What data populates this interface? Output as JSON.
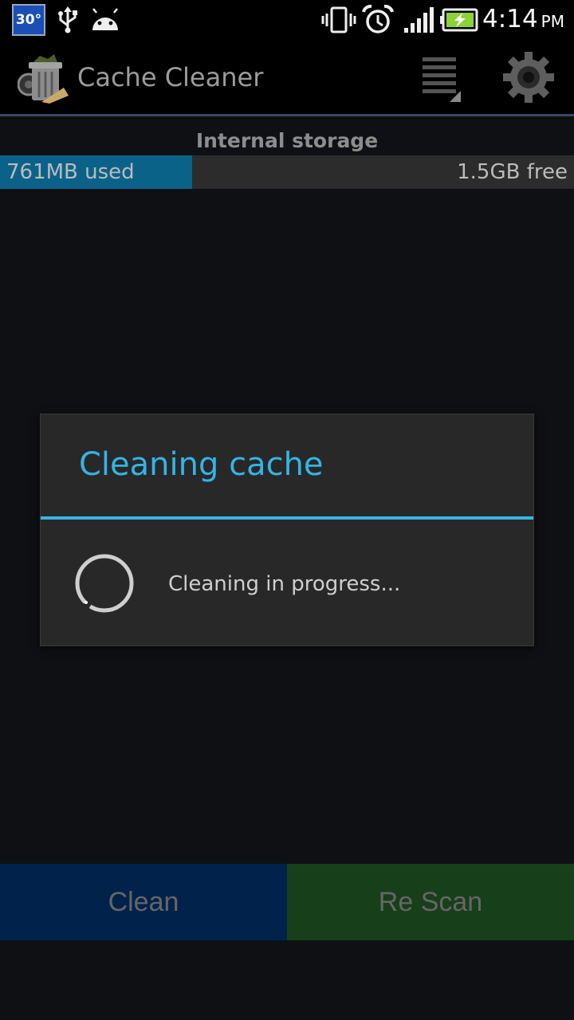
{
  "status_bar": {
    "temperature_badge": "30°",
    "icons": [
      "usb-icon",
      "android-icon",
      "vibrate-icon",
      "alarm-icon",
      "signal-icon",
      "battery-charging-icon"
    ],
    "time": "4:14",
    "ampm": "PM"
  },
  "action_bar": {
    "title": "Cache Cleaner",
    "icons": [
      "app-trash-icon",
      "overflow-menu-icon",
      "settings-gear-icon"
    ]
  },
  "storage": {
    "label": "Internal storage",
    "used_text": "761MB used",
    "free_text": "1.5GB free",
    "used_fraction": 0.335,
    "used_color": "#0b6289"
  },
  "dialog": {
    "title": "Cleaning cache",
    "message": "Cleaning in progress...",
    "accent_color": "#33b5e5"
  },
  "buttons": {
    "clean_label": "Clean",
    "rescan_label": "Re Scan"
  }
}
